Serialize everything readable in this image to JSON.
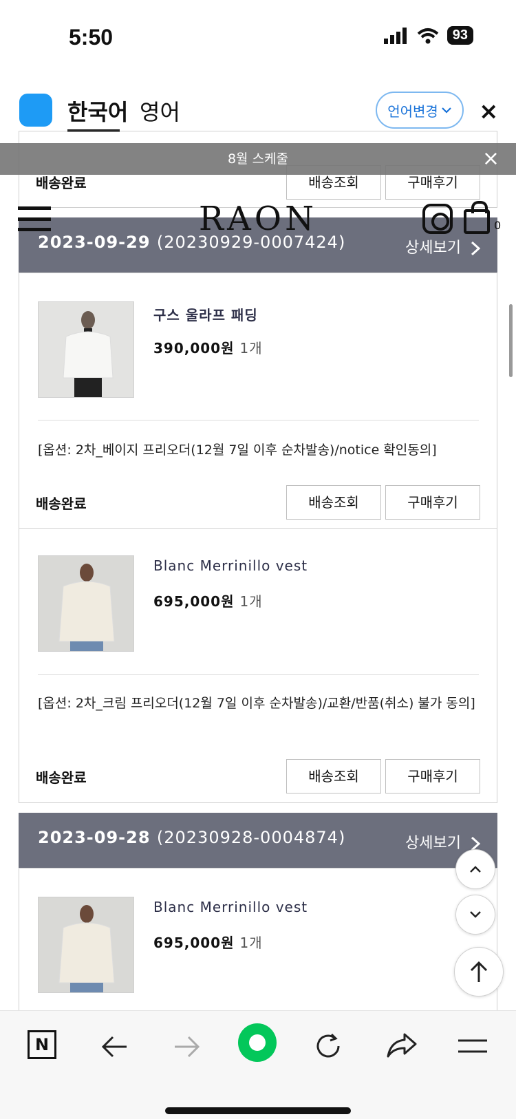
{
  "status_bar": {
    "time": "5:50",
    "battery": "93"
  },
  "translate_bar": {
    "tabs": [
      "한국어",
      "영어"
    ],
    "change_button": "언어변경",
    "close": "×"
  },
  "notice": {
    "text": "8월 스케줄",
    "close": "×"
  },
  "site": {
    "logo": "RAON",
    "cart_count": "0"
  },
  "labels": {
    "detail": "상세보기",
    "track": "배송조회",
    "review": "구매후기",
    "delivered": "배송완료",
    "qty": "1개"
  },
  "orders": [
    {
      "date": "2023-09-29",
      "number": "(20230929-0007424)",
      "items": [
        {
          "name": "구스 울라프 패딩",
          "price": "390,000원",
          "option": "[옵션: 2차_베이지 프리오더(12월 7일 이후 순차발송)/notice 확인동의]"
        },
        {
          "name": "Blanc Merrinillo vest",
          "price": "695,000원",
          "option": "[옵션: 2차_크림 프리오더(12월 7일 이후 순차발송)/교환/반품(취소) 불가 동의]"
        }
      ]
    },
    {
      "date": "2023-09-28",
      "number": "(20230928-0004874)",
      "items": [
        {
          "name": "Blanc Merrinillo vest",
          "price": "695,000원"
        }
      ]
    }
  ],
  "browser_nav": {
    "n_label": "N"
  }
}
